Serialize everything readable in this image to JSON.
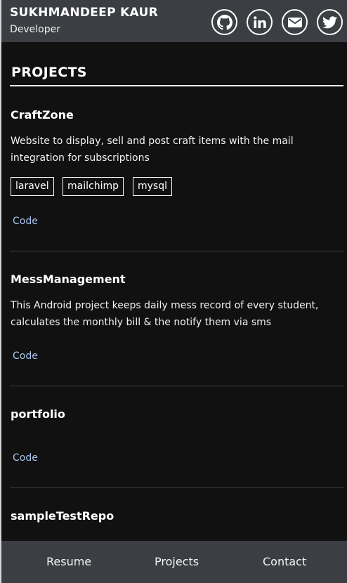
{
  "header": {
    "name": "SUKHMANDEEP KAUR",
    "role": "Developer",
    "social_icons": [
      "github-icon",
      "linkedin-icon",
      "mail-icon",
      "twitter-icon"
    ]
  },
  "section_title": "PROJECTS",
  "projects": [
    {
      "name": "CraftZone",
      "description": "Website to display, sell and post craft items with the mail integration for subscriptions",
      "tags": [
        "laravel",
        "mailchimp",
        "mysql"
      ],
      "code_label": "Code"
    },
    {
      "name": "MessManagement",
      "description": "This Android project keeps daily mess record of every student, calculates the monthly bill & the notify them via sms",
      "tags": [],
      "code_label": "Code"
    },
    {
      "name": "portfolio",
      "description": "",
      "tags": [],
      "code_label": "Code"
    },
    {
      "name": "sampleTestRepo",
      "description": "",
      "tags": [],
      "code_label": ""
    }
  ],
  "footer": {
    "nav": [
      "Resume",
      "Projects",
      "Contact"
    ]
  },
  "colors": {
    "header_bg": "#3b3e42",
    "page_bg": "#111111",
    "link": "#a9c4ea"
  }
}
